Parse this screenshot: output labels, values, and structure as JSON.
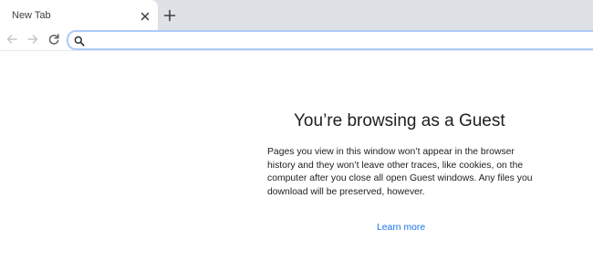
{
  "tabs": [
    {
      "title": "New Tab",
      "active": true
    }
  ],
  "toolbar": {
    "omnibox_value": ""
  },
  "guest": {
    "title": "You’re browsing as a Guest",
    "body": "Pages you view in this window won’t appear in the browser history and they won’t leave other traces, like cookies, on the computer after you close all open Guest windows. Any files you download will be preserved, however.",
    "learn_more": "Learn more"
  },
  "colors": {
    "tabstrip": "#dee1e6",
    "omnibox_focus_border": "#aecbfa",
    "link": "#1a73e8",
    "text": "#202124"
  },
  "icons": {
    "tab_close": "close-icon",
    "new_tab": "plus-icon",
    "back": "arrow-left-icon",
    "forward": "arrow-right-icon",
    "reload": "reload-icon",
    "omnibox": "search-icon"
  }
}
